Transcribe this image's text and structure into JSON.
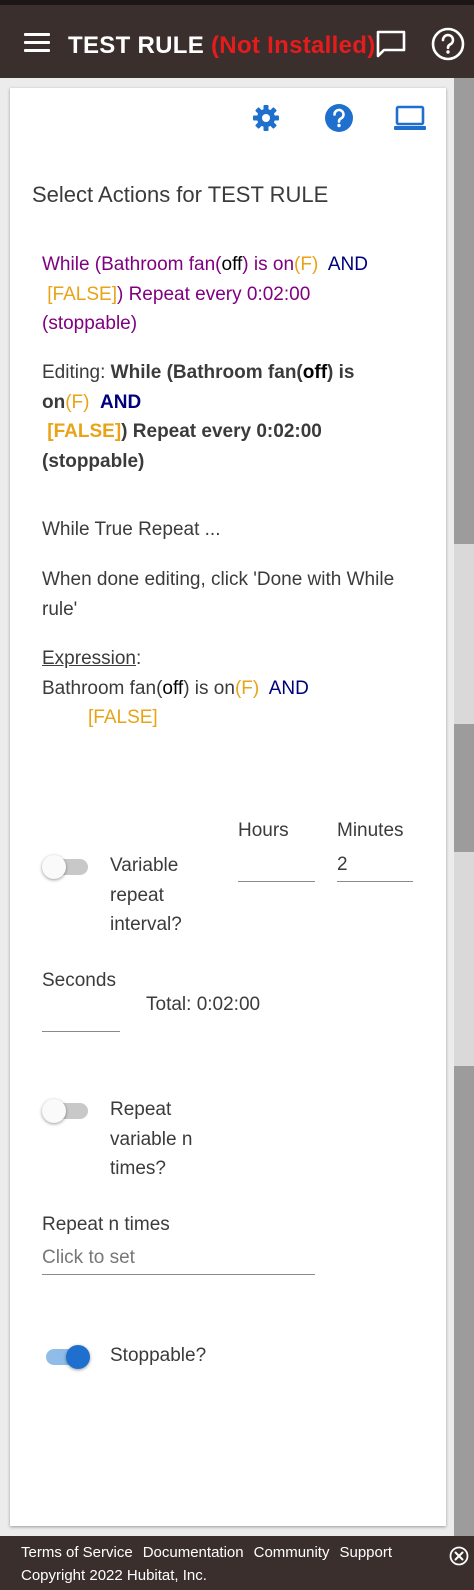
{
  "header": {
    "title": "TEST RULE",
    "status": "(Not Installed)"
  },
  "toolbar": {
    "settings_icon": "gear-icon",
    "help_icon": "help-circle-icon",
    "view_icon": "laptop-icon"
  },
  "page": {
    "heading": "Select Actions for TEST RULE"
  },
  "while_summary": {
    "prefix": "While (Bathroom fan(",
    "state": "off",
    "mid": ") is on",
    "flag": "(F)",
    "and": "AND",
    "false_tag": "[FALSE]",
    "suffix": ") Repeat every 0:02:00",
    "stoppable": "(stoppable)"
  },
  "editing": {
    "label": "Editing: ",
    "prefix": "While (Bathroom fan(",
    "state": "off",
    "mid": ") is",
    "on": "on",
    "flag": "(F)",
    "and": "AND",
    "false_tag": "[FALSE]",
    "suffix": ") Repeat every 0:02:00",
    "stoppable": "(stoppable)"
  },
  "info": {
    "while_true": "While True Repeat ...",
    "done_hint": "When done editing, click 'Done with While rule'"
  },
  "expression": {
    "label": "Expression",
    "colon": ":",
    "prefix": "Bathroom fan(",
    "state": "off",
    "mid": ") is on",
    "flag": "(F)",
    "and": "AND",
    "false_tag": "[FALSE]"
  },
  "variable_interval": {
    "label": "Variable repeat interval?",
    "on": false
  },
  "hours": {
    "label": "Hours",
    "value": ""
  },
  "minutes": {
    "label": "Minutes",
    "value": "2"
  },
  "seconds": {
    "label": "Seconds",
    "value": ""
  },
  "total": "Total: 0:02:00",
  "repeat_variable": {
    "label": "Repeat variable n times?",
    "on": false
  },
  "repeat_n": {
    "label": "Repeat n times",
    "placeholder": "Click to set"
  },
  "stoppable": {
    "label": "Stoppable?",
    "on": true
  },
  "colors": {
    "header_bg": "#3a2f2d",
    "status_red": "#e61c1c",
    "accent_blue": "#1e6fce",
    "purple": "#800080",
    "orange": "#e8a317",
    "navy": "#00007d"
  },
  "footer": {
    "links": [
      "Terms of Service",
      "Documentation",
      "Community",
      "Support"
    ],
    "copyright": "Copyright 2022 Hubitat, Inc.",
    "close_icon": "close-circle-icon"
  }
}
